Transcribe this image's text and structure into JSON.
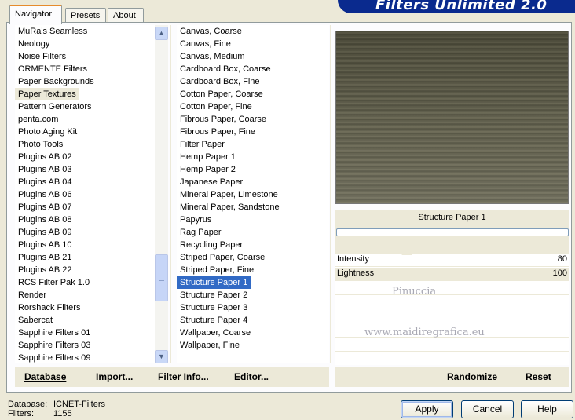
{
  "banner": {
    "title": "Filters Unlimited 2.0"
  },
  "tabs": [
    "Navigator",
    "Presets",
    "About"
  ],
  "categories": [
    "MuRa's Seamless",
    "Neology",
    "Noise Filters",
    "ORMENTE Filters",
    "Paper Backgrounds",
    "Paper Textures",
    "Pattern Generators",
    "penta.com",
    "Photo Aging Kit",
    "Photo Tools",
    "Plugins AB 02",
    "Plugins AB 03",
    "Plugins AB 04",
    "Plugins AB 06",
    "Plugins AB 07",
    "Plugins AB 08",
    "Plugins AB 09",
    "Plugins AB 10",
    "Plugins AB 21",
    "Plugins AB 22",
    "RCS Filter Pak 1.0",
    "Render",
    "Rorshack Filters",
    "Sabercat",
    "Sapphire Filters 01",
    "Sapphire Filters 03",
    "Sapphire Filters 09"
  ],
  "selected_category": "Paper Textures",
  "filters": [
    "Canvas, Coarse",
    "Canvas, Fine",
    "Canvas, Medium",
    "Cardboard Box, Coarse",
    "Cardboard Box, Fine",
    "Cotton Paper, Coarse",
    "Cotton Paper, Fine",
    "Fibrous Paper, Coarse",
    "Fibrous Paper, Fine",
    "Filter Paper",
    "Hemp Paper 1",
    "Hemp Paper 2",
    "Japanese Paper",
    "Mineral Paper, Limestone",
    "Mineral Paper, Sandstone",
    "Papyrus",
    "Rag Paper",
    "Recycling Paper",
    "Striped Paper, Coarse",
    "Striped Paper, Fine",
    "Structure Paper 1",
    "Structure Paper 2",
    "Structure Paper 3",
    "Structure Paper 4",
    "Wallpaper, Coarse",
    "Wallpaper, Fine"
  ],
  "selected_filter": "Structure Paper 1",
  "filter_title": "Structure Paper 1",
  "params": [
    {
      "label": "Intensity",
      "value": "80"
    },
    {
      "label": "Lightness",
      "value": "100"
    }
  ],
  "watermark": {
    "line1": "Pinuccia",
    "line2": "www.maidiregrafica.eu"
  },
  "bottom_buttons": [
    "Database",
    "Import...",
    "Filter Info...",
    "Editor..."
  ],
  "bottom_right_buttons": [
    "Randomize",
    "Reset"
  ],
  "footer": {
    "database_label": "Database:",
    "database_value": "ICNET-Filters",
    "filters_label": "Filters:",
    "filters_value": "1155"
  },
  "dialog_buttons": {
    "apply": "Apply",
    "cancel": "Cancel",
    "help": "Help"
  },
  "colors": {
    "banner": "#0a2a8e",
    "selection": "#316ac5",
    "tab_accent": "#e68b2c"
  }
}
